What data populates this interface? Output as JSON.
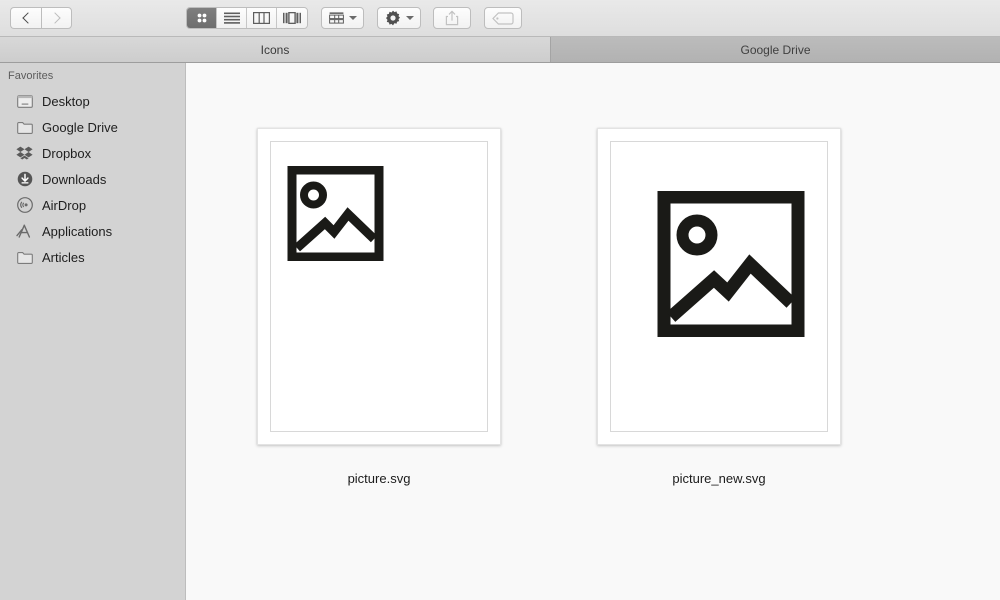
{
  "window": {
    "title": "Icons"
  },
  "toolbar": {
    "nav": {
      "back_label": "Back",
      "back_icon": "chevron-left-icon",
      "back_enabled": true,
      "forward_label": "Forward",
      "forward_icon": "chevron-right-icon",
      "forward_enabled": false
    },
    "view_modes": [
      {
        "id": "icon",
        "label": "Icon View",
        "icon": "grid-view-icon",
        "active": true
      },
      {
        "id": "list",
        "label": "List View",
        "icon": "list-view-icon",
        "active": false
      },
      {
        "id": "column",
        "label": "Column View",
        "icon": "column-view-icon",
        "active": false
      },
      {
        "id": "gallery",
        "label": "Cover Flow View",
        "icon": "coverflow-view-icon",
        "active": false
      }
    ],
    "arrange": {
      "label": "Arrange By",
      "icon": "arrange-grid-icon",
      "chevron": "chevron-down-icon"
    },
    "action": {
      "label": "Action",
      "icon": "gear-icon",
      "chevron": "chevron-down-icon"
    },
    "share": {
      "label": "Share",
      "icon": "share-icon",
      "enabled": false
    },
    "tag": {
      "label": "Tags",
      "icon": "tag-icon",
      "enabled": false
    }
  },
  "tabs": [
    {
      "label": "Icons",
      "active": true
    },
    {
      "label": "Google Drive",
      "active": false
    }
  ],
  "sidebar": {
    "section_title": "Favorites",
    "items": [
      {
        "label": "Desktop",
        "icon": "desktop-icon"
      },
      {
        "label": "Google Drive",
        "icon": "folder-icon"
      },
      {
        "label": "Dropbox",
        "icon": "dropbox-icon"
      },
      {
        "label": "Downloads",
        "icon": "downloads-icon"
      },
      {
        "label": "AirDrop",
        "icon": "airdrop-icon"
      },
      {
        "label": "Applications",
        "icon": "applications-icon"
      },
      {
        "label": "Articles",
        "icon": "folder-icon"
      }
    ]
  },
  "files": [
    {
      "name": "picture.svg",
      "kind": "svg-image",
      "preview": "image-placeholder-icon",
      "preview_size": "small"
    },
    {
      "name": "picture_new.svg",
      "kind": "svg-image",
      "preview": "image-placeholder-icon",
      "preview_size": "large"
    }
  ],
  "colors": {
    "toolbar_bg": "#e4e4e4",
    "sidebar_bg": "#d3d3d3",
    "content_bg": "#f9f9f9",
    "active_tab_bg": "#d2d2d2",
    "inactive_tab_bg": "#b6b6b6",
    "artwork": "#1a1a17"
  }
}
